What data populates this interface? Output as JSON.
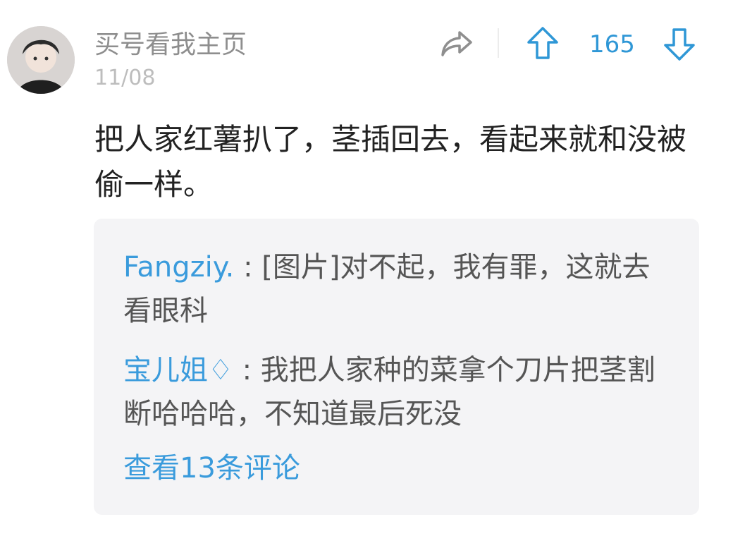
{
  "post": {
    "username": "买号看我主页",
    "date": "11/08",
    "score": "165",
    "text": "把人家红薯扒了，茎插回去，看起来就和没被偷一样。"
  },
  "icons": {
    "share": "share-arrow-icon",
    "upvote": "arrow-up-icon",
    "downvote": "arrow-down-icon"
  },
  "colors": {
    "accent": "#3a9bdc",
    "username": "#8e8e8e",
    "date": "#bdbdbd",
    "comment_bg": "#f4f4f6"
  },
  "comments": [
    {
      "author": "Fangziy.",
      "separator": " : ",
      "text": "[图片]对不起，我有罪，这就去看眼科"
    },
    {
      "author": "宝儿姐♢",
      "separator": " : ",
      "text": "我把人家种的菜拿个刀片把茎割断哈哈哈，不知道最后死没"
    }
  ],
  "view_more_label": "查看13条评论"
}
